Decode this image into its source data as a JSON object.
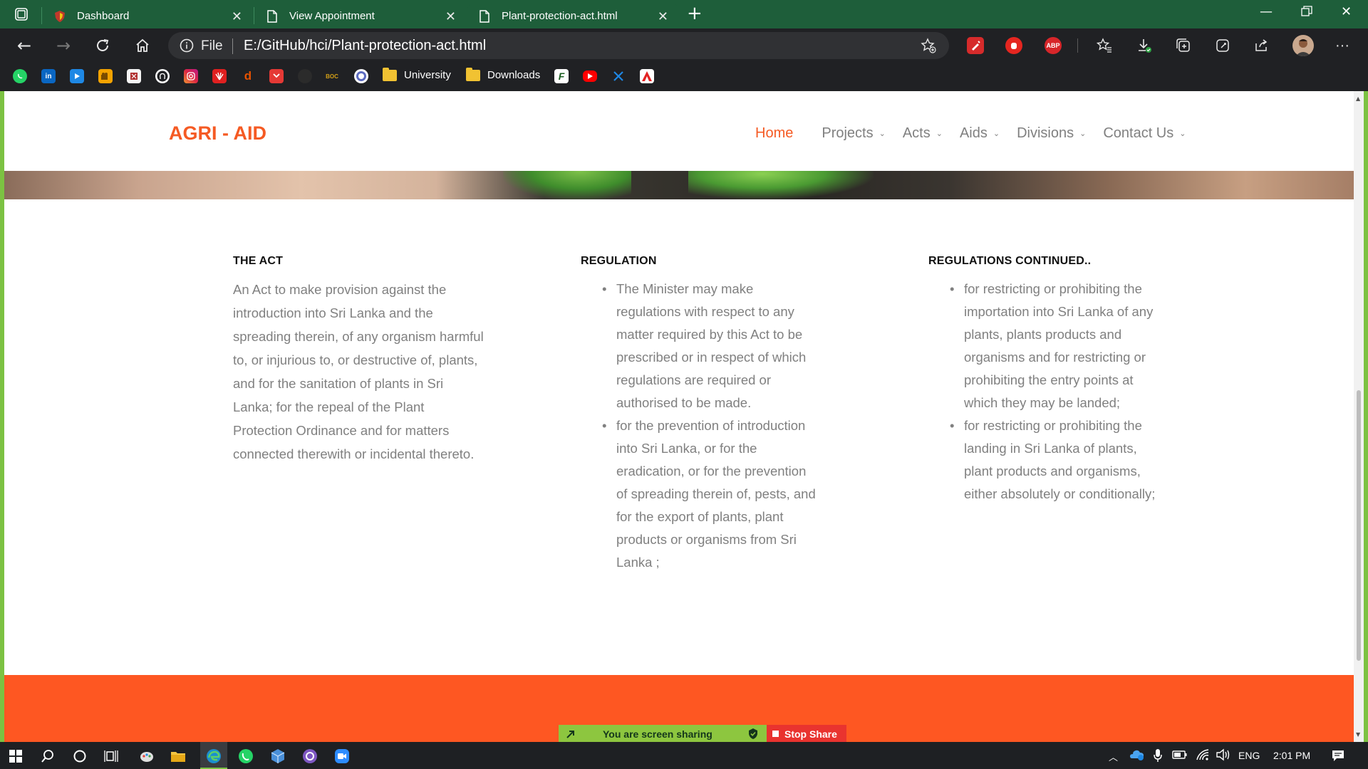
{
  "browser": {
    "tabs": [
      {
        "title": "Dashboard",
        "active": false
      },
      {
        "title": "View Appointment",
        "active": false
      },
      {
        "title": "Plant-protection-act.html",
        "active": true
      }
    ],
    "address": {
      "scheme_label": "File",
      "url": "E:/GitHub/hci/Plant-protection-act.html"
    },
    "extensions": [
      "pen-extension-icon",
      "hand-stop-extension-icon",
      "adblock-plus-icon"
    ],
    "adblock_label": "ABP",
    "bookmarks": {
      "folders": [
        "University",
        "Downloads"
      ],
      "boc_label": "BOC"
    }
  },
  "site": {
    "logo": "AGRI - AID",
    "nav": [
      {
        "label": "Home",
        "active": true,
        "has_dropdown": false
      },
      {
        "label": "Projects",
        "active": false,
        "has_dropdown": true
      },
      {
        "label": "Acts",
        "active": false,
        "has_dropdown": true
      },
      {
        "label": "Aids",
        "active": false,
        "has_dropdown": true
      },
      {
        "label": "Divisions",
        "active": false,
        "has_dropdown": true
      },
      {
        "label": "Contact Us",
        "active": false,
        "has_dropdown": true
      }
    ],
    "colors": {
      "accent": "#f55a23",
      "footer": "#fe5722",
      "body_text": "#808080"
    },
    "columns": [
      {
        "heading": "THE ACT",
        "paragraph_lines": [
          "An Act to make provision against the",
          "introduction into Sri Lanka and the",
          "spreading therein, of any organism harmful",
          "to, or injurious to, or destructive of, plants,",
          "and for the sanitation of plants in Sri",
          "Lanka; for the repeal of the Plant",
          "Protection Ordinance and for matters",
          "connected therewith or incidental thereto."
        ]
      },
      {
        "heading": "REGULATION",
        "items": [
          [
            "The Minister may make",
            "regulations with respect to any",
            "matter required by this Act to be",
            "prescribed or in respect of which",
            "regulations are required or",
            "authorised to be made."
          ],
          [
            "for the prevention of introduction",
            "into Sri Lanka, or for the",
            "eradication, or for the prevention",
            "of spreading therein of, pests, and",
            "for the export of plants, plant",
            "products or organisms from Sri",
            "Lanka ;"
          ]
        ]
      },
      {
        "heading": "REGULATIONS CONTINUED..",
        "items": [
          [
            "for restricting or prohibiting the",
            "importation into Sri Lanka of any",
            "plants, plants products and",
            "organisms and for restricting or",
            "prohibiting the entry points at",
            "which they may be landed;"
          ],
          [
            "for restricting or prohibiting the",
            "landing in Sri Lanka of plants,",
            "plant products and organisms,",
            "either absolutely or conditionally;"
          ]
        ]
      }
    ]
  },
  "screenshare": {
    "status": "You are screen sharing",
    "stop_label": "Stop Share"
  },
  "taskbar": {
    "language": "ENG",
    "time": "2:01 PM"
  }
}
